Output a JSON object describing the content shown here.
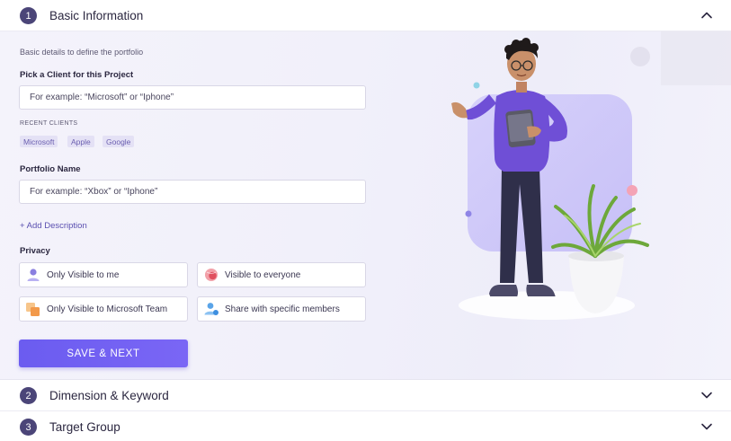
{
  "steps": [
    {
      "number": "1",
      "title": "Basic Information"
    },
    {
      "number": "2",
      "title": "Dimension & Keyword"
    },
    {
      "number": "3",
      "title": "Target Group"
    }
  ],
  "basic": {
    "subtitle": "Basic details to define the portfolio",
    "client_label": "Pick a Client for this Project",
    "client_placeholder": "For example: “Microsoft” or “Iphone”",
    "client_value": "",
    "recent_label": "RECENT CLIENTS",
    "recent_clients": [
      "Microsoft",
      "Apple",
      "Google"
    ],
    "portfolio_label": "Portfolio Name",
    "portfolio_placeholder": "For example: “Xbox” or “Iphone”",
    "portfolio_value": "",
    "add_description": "+ Add Description",
    "privacy_label": "Privacy",
    "privacy_options": [
      {
        "label": "Only Visible to me",
        "icon": "user-icon"
      },
      {
        "label": "Visible to everyone",
        "icon": "globe-icon"
      },
      {
        "label": "Only Visible to Microsoft Team",
        "icon": "team-icon"
      },
      {
        "label": "Share with specific members",
        "icon": "share-members-icon"
      }
    ],
    "save_label": "SAVE & NEXT"
  },
  "colors": {
    "accent": "#6b5cf0",
    "step_badge": "#4b4578",
    "chip_bg": "#e4e1f5",
    "link": "#5a4fb0"
  }
}
